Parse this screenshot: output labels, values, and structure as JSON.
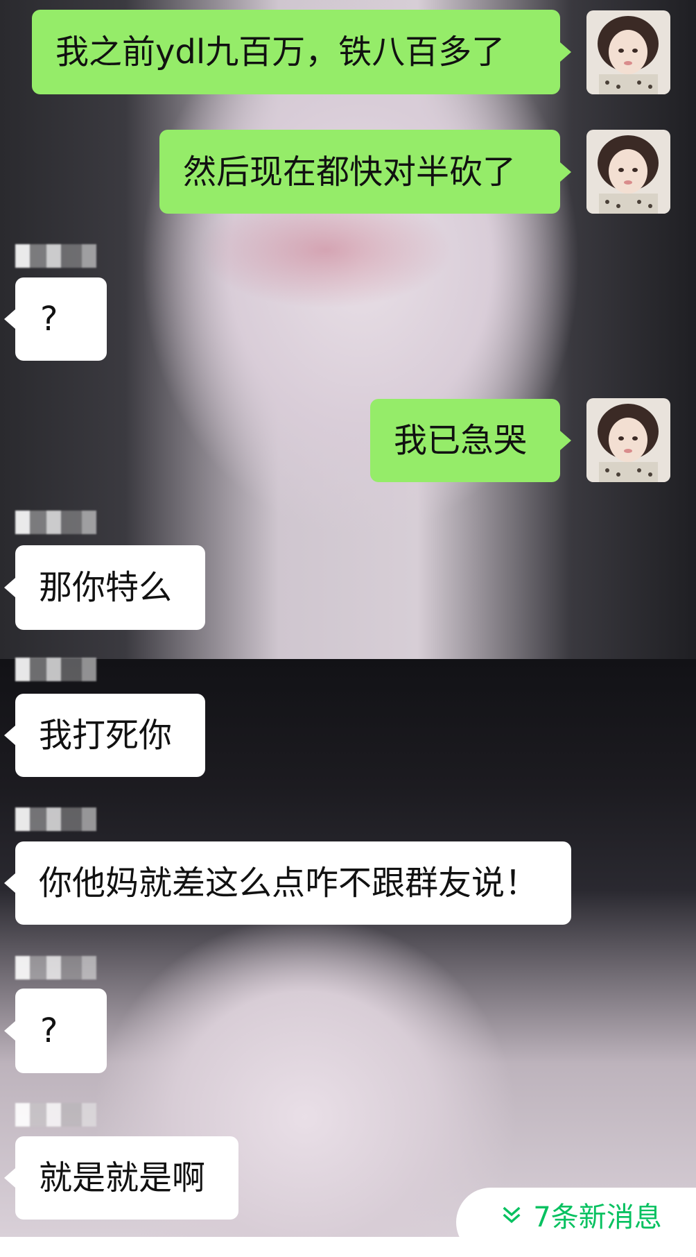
{
  "chat": {
    "messages": [
      {
        "sender": "me",
        "text": "我之前ydl九百万，铁八百多了"
      },
      {
        "sender": "me",
        "text": "然后现在都快对半砍了"
      },
      {
        "sender": "other",
        "text": "?"
      },
      {
        "sender": "me",
        "text": "我已急哭"
      },
      {
        "sender": "other",
        "text": "那你特么"
      },
      {
        "sender": "other",
        "text": "我打死你"
      },
      {
        "sender": "other",
        "text": "你他妈就差这么点咋不跟群友说！"
      },
      {
        "sender": "other",
        "text": "?"
      },
      {
        "sender": "other",
        "text": "就是就是啊"
      }
    ],
    "new_messages_label": "7条新消息"
  },
  "colors": {
    "my_bubble": "#95ec69",
    "other_bubble": "#ffffff",
    "new_message_accent": "#07c160"
  },
  "icons": {
    "new_messages": "double-chevron-down-icon"
  }
}
